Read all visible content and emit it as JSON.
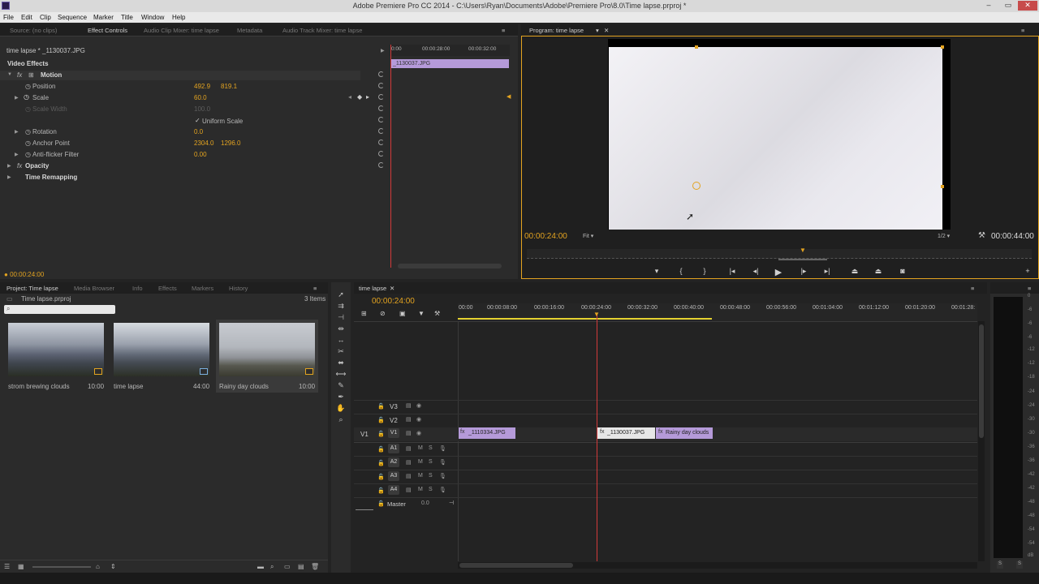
{
  "window": {
    "title": "Adobe Premiere Pro CC 2014 - C:\\Users\\Ryan\\Documents\\Adobe\\Premiere Pro\\8.0\\Time lapse.prproj *",
    "minimize": "–",
    "maximize": "▭",
    "close": "✕"
  },
  "menu": [
    "File",
    "Edit",
    "Clip",
    "Sequence",
    "Marker",
    "Title",
    "Window",
    "Help"
  ],
  "source_panel": {
    "tabs": [
      "Source: (no clips)",
      "Effect Controls",
      "Audio Clip Mixer: time lapse",
      "Metadata",
      "Audio Track Mixer: time lapse"
    ],
    "clip_path": "time lapse * _1130037.JPG",
    "mini_timecodes": [
      "0:00",
      "00:00:28:00",
      "00:00:32:00"
    ],
    "mini_clip": "_1130037.JPG",
    "section": "Video Effects",
    "motion": "Motion",
    "position_label": "Position",
    "position_x": "492.9",
    "position_y": "819.1",
    "scale_label": "Scale",
    "scale_value": "60.0",
    "scale_width_label": "Scale Width",
    "scale_width_value": "100.0",
    "uniform_scale": "Uniform Scale",
    "rotation_label": "Rotation",
    "rotation_value": "0.0",
    "anchor_label": "Anchor Point",
    "anchor_x": "2304.0",
    "anchor_y": "1296.0",
    "antiflicker_label": "Anti-flicker Filter",
    "antiflicker_value": "0.00",
    "opacity": "Opacity",
    "time_remap": "Time Remapping",
    "footer_time": "00:00:24:00"
  },
  "program": {
    "tab": "Program: time lapse",
    "current_time": "00:00:24:00",
    "zoom": "Fit",
    "resolution": "1/2",
    "duration": "00:00:44:00"
  },
  "project": {
    "tabs": [
      "Project: Time lapse",
      "Media Browser",
      "Info",
      "Effects",
      "Markers",
      "History"
    ],
    "file": "Time lapse.prproj",
    "count": "3 Items",
    "items": [
      {
        "name": "strom brewing clouds",
        "duration": "10:00"
      },
      {
        "name": "time lapse",
        "duration": "44:00"
      },
      {
        "name": "Rainy day clouds",
        "duration": "10:00"
      }
    ]
  },
  "timeline": {
    "tab": "time lapse",
    "current_time": "00:00:24:00",
    "ruler": [
      "00:00",
      "00:00:08:00",
      "00:00:16:00",
      "00:00:24:00",
      "00:00:32:00",
      "00:00:40:00",
      "00:00:48:00",
      "00:00:56:00",
      "00:01:04:00",
      "00:01:12:00",
      "00:01:20:00",
      "00:01:28:"
    ],
    "video_tracks": [
      "V3",
      "V2",
      "V1"
    ],
    "source_patch": "V1",
    "audio_tracks": [
      "A1",
      "A2",
      "A3",
      "A4"
    ],
    "mute": "M",
    "solo": "S",
    "master": "Master",
    "master_value": "0.0",
    "clips": [
      "_1110334.JPG",
      "_1130037.JPG",
      "Rainy day clouds"
    ]
  },
  "meter": {
    "labels": [
      "0",
      "-6",
      "-12",
      "-18",
      "-24",
      "-30",
      "-36",
      "-42",
      "-48",
      "-54",
      "dB"
    ],
    "solo": [
      "S",
      "S"
    ]
  },
  "colors": {
    "accent": "#e3a320",
    "clip_purple": "#b59ad9",
    "playhead": "#d23a3a"
  }
}
